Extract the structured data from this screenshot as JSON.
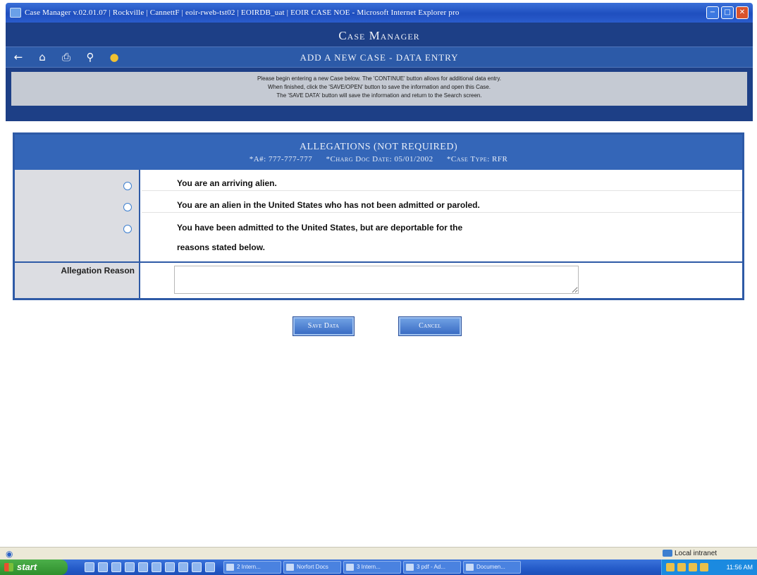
{
  "window": {
    "title": "Case Manager v.02.01.07 | Rockville | CannettF | eoir-rweb-tst02 | EOIRDB_uat | EOIR CASE NOE - Microsoft Internet Explorer pro",
    "min_icon": "minimize-icon",
    "max_icon": "maximize-icon",
    "close_icon": "close-icon"
  },
  "header": {
    "app_title": "Case Manager",
    "page_heading": "ADD A NEW CASE - DATA ENTRY",
    "nav_icons": [
      "back-arrow-icon",
      "home-icon",
      "print-icon",
      "search-icon",
      "help-icon"
    ],
    "instructions": [
      "Please begin entering a new Case below. The 'CONTINUE' button allows for additional data entry.",
      "When finished, click the 'SAVE/OPEN' button to save the information and open this Case.",
      "The 'SAVE DATA' button will save the information and return to the Search screen."
    ]
  },
  "allegations": {
    "title": "ALLEGATIONS (NOT REQUIRED)",
    "meta": {
      "a_number": "*A#: 777-777-777",
      "charg_doc_date": "*Charg Doc Date: 05/01/2002",
      "case_type": "*Case Type: RFR"
    },
    "options": [
      "You are an arriving alien.",
      "You are an alien in the United States who has not been admitted or paroled.",
      "You have been admitted to the United States, but are deportable for the",
      "reasons stated below."
    ],
    "reason_label": "Allegation Reason",
    "reason_value": ""
  },
  "buttons": {
    "save": "Save Data",
    "cancel": "Cancel"
  },
  "statusbar": {
    "zone": "Local intranet"
  },
  "taskbar": {
    "start": "start",
    "tasks": [
      "2 Intern...",
      "Norfort Docs",
      "3 Intern...",
      "3 pdf - Ad...",
      "Documen..."
    ],
    "clock": "11:56 AM"
  }
}
